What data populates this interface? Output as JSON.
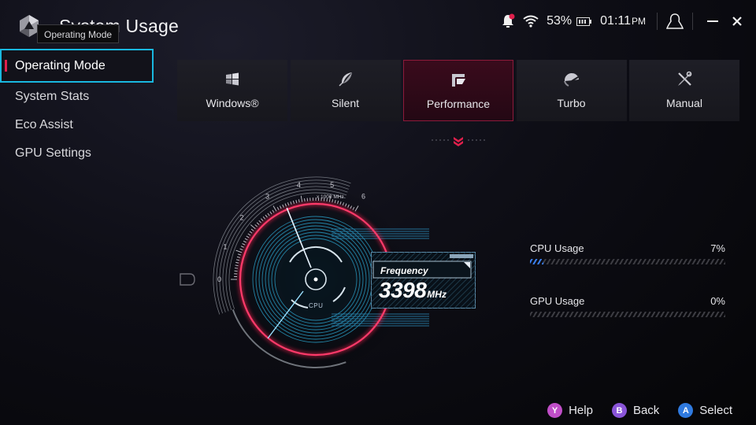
{
  "header": {
    "title": "System Usage",
    "tooltip": "Operating Mode",
    "app_icon": "rog-armoury-crate-logo-icon"
  },
  "status_bar": {
    "notification_icon": "bell-icon",
    "wifi_icon": "wifi-icon",
    "battery_percent": "53%",
    "battery_icon": "battery-icon",
    "time": "01:11",
    "time_suffix": "PM",
    "profile_icon": "user-profile-icon",
    "minimize_icon": "minimize-icon",
    "close_icon": "close-icon",
    "colors": {
      "notification_dot": "#e0204c"
    }
  },
  "sidebar": {
    "items": [
      {
        "label": "Operating Mode",
        "active": true
      },
      {
        "label": "System Stats",
        "active": false
      },
      {
        "label": "Eco Assist",
        "active": false
      },
      {
        "label": "GPU Settings",
        "active": false
      }
    ]
  },
  "modes": [
    {
      "label": "Windows®",
      "icon": "windows-icon",
      "active": false
    },
    {
      "label": "Silent",
      "icon": "leaf-icon",
      "active": false
    },
    {
      "label": "Performance",
      "icon": "performance-icon",
      "active": true
    },
    {
      "label": "Turbo",
      "icon": "turbo-gauge-icon",
      "active": false
    },
    {
      "label": "Manual",
      "icon": "wrench-screwdriver-icon",
      "active": false
    }
  ],
  "gauge": {
    "label": "CPU",
    "scale_unit": "x 1000 MHz",
    "ticks": [
      "0",
      "1",
      "2",
      "3",
      "4",
      "5",
      "6"
    ],
    "frequency_label": "Frequency",
    "frequency_value": "3398",
    "frequency_unit": "MHz",
    "frequency_mhz": 3398,
    "scale_max_ghz": 6
  },
  "usage": [
    {
      "label": "CPU Usage",
      "value": "7%",
      "percent": 7
    },
    {
      "label": "GPU Usage",
      "value": "0%",
      "percent": 0
    }
  ],
  "footer": {
    "hints": [
      {
        "key": "Y",
        "label": "Help",
        "color": "#c04ec8"
      },
      {
        "key": "B",
        "label": "Back",
        "color": "#8a55d8"
      },
      {
        "key": "A",
        "label": "Select",
        "color": "#2f7ae0"
      }
    ]
  },
  "colors": {
    "accent": "#e0204c",
    "focus": "#19b8e0",
    "bar_fill": "#3a7ff0"
  }
}
